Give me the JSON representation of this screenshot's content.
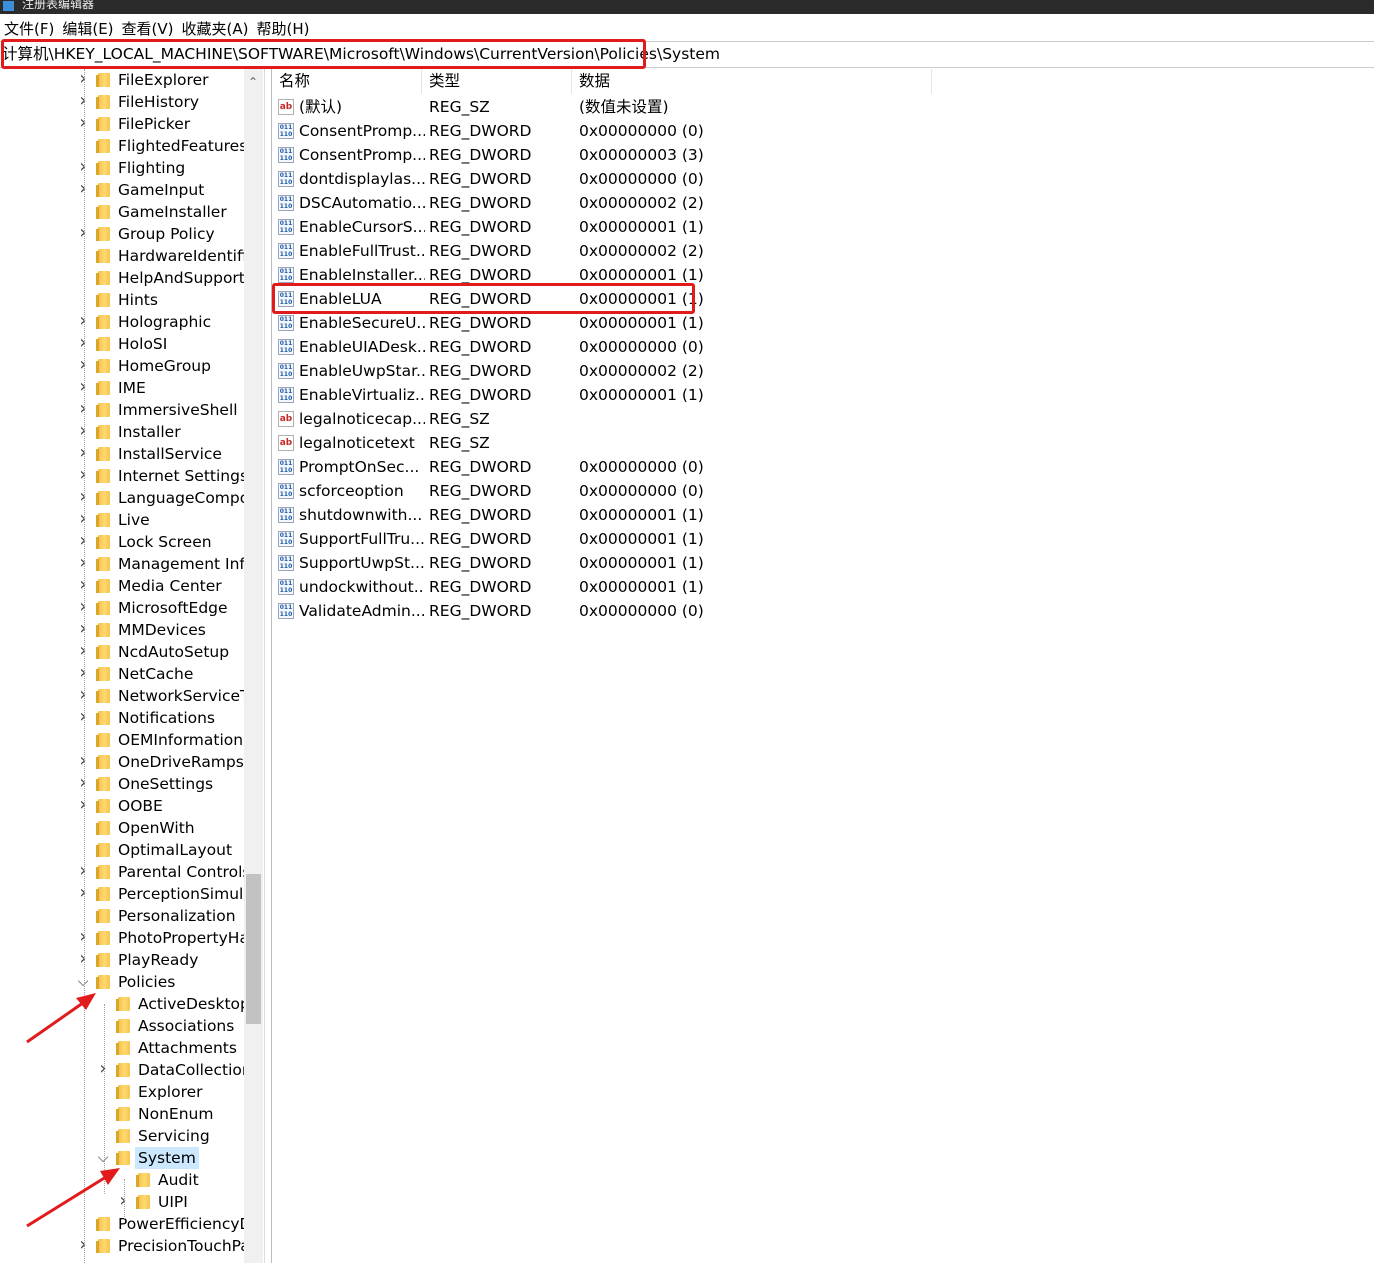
{
  "window": {
    "title": "注册表编辑器"
  },
  "menu": [
    "文件(F)",
    "编辑(E)",
    "查看(V)",
    "收藏夹(A)",
    "帮助(H)"
  ],
  "address": "计算机\\HKEY_LOCAL_MACHINE\\SOFTWARE\\Microsoft\\Windows\\CurrentVersion\\Policies\\System",
  "columns": {
    "name": "名称",
    "type": "类型",
    "data": "数据"
  },
  "tree": [
    {
      "label": "FileExplorer",
      "expand": "collapsed",
      "level": 0
    },
    {
      "label": "FileHistory",
      "expand": "collapsed",
      "level": 0
    },
    {
      "label": "FilePicker",
      "expand": "collapsed",
      "level": 0
    },
    {
      "label": "FlightedFeatures",
      "expand": "none",
      "level": 0
    },
    {
      "label": "Flighting",
      "expand": "collapsed",
      "level": 0
    },
    {
      "label": "GameInput",
      "expand": "collapsed",
      "level": 0
    },
    {
      "label": "GameInstaller",
      "expand": "none",
      "level": 0
    },
    {
      "label": "Group Policy",
      "expand": "collapsed",
      "level": 0
    },
    {
      "label": "HardwareIdentific",
      "expand": "none",
      "level": 0
    },
    {
      "label": "HelpAndSupport",
      "expand": "none",
      "level": 0
    },
    {
      "label": "Hints",
      "expand": "none",
      "level": 0
    },
    {
      "label": "Holographic",
      "expand": "collapsed",
      "level": 0
    },
    {
      "label": "HoloSI",
      "expand": "collapsed",
      "level": 0
    },
    {
      "label": "HomeGroup",
      "expand": "collapsed",
      "level": 0
    },
    {
      "label": "IME",
      "expand": "collapsed",
      "level": 0
    },
    {
      "label": "ImmersiveShell",
      "expand": "collapsed",
      "level": 0
    },
    {
      "label": "Installer",
      "expand": "collapsed",
      "level": 0
    },
    {
      "label": "InstallService",
      "expand": "collapsed",
      "level": 0
    },
    {
      "label": "Internet Settings",
      "expand": "collapsed",
      "level": 0
    },
    {
      "label": "LanguageCompo",
      "expand": "collapsed",
      "level": 0
    },
    {
      "label": "Live",
      "expand": "collapsed",
      "level": 0
    },
    {
      "label": "Lock Screen",
      "expand": "collapsed",
      "level": 0
    },
    {
      "label": "Management Infr",
      "expand": "collapsed",
      "level": 0
    },
    {
      "label": "Media Center",
      "expand": "collapsed",
      "level": 0
    },
    {
      "label": "MicrosoftEdge",
      "expand": "collapsed",
      "level": 0
    },
    {
      "label": "MMDevices",
      "expand": "collapsed",
      "level": 0
    },
    {
      "label": "NcdAutoSetup",
      "expand": "collapsed",
      "level": 0
    },
    {
      "label": "NetCache",
      "expand": "collapsed",
      "level": 0
    },
    {
      "label": "NetworkServiceT",
      "expand": "collapsed",
      "level": 0
    },
    {
      "label": "Notifications",
      "expand": "collapsed",
      "level": 0
    },
    {
      "label": "OEMInformation",
      "expand": "none",
      "level": 0
    },
    {
      "label": "OneDriveRamps",
      "expand": "collapsed",
      "level": 0
    },
    {
      "label": "OneSettings",
      "expand": "collapsed",
      "level": 0
    },
    {
      "label": "OOBE",
      "expand": "collapsed",
      "level": 0
    },
    {
      "label": "OpenWith",
      "expand": "none",
      "level": 0
    },
    {
      "label": "OptimalLayout",
      "expand": "none",
      "level": 0
    },
    {
      "label": "Parental Controls",
      "expand": "collapsed",
      "level": 0
    },
    {
      "label": "PerceptionSimula",
      "expand": "collapsed",
      "level": 0
    },
    {
      "label": "Personalization",
      "expand": "none",
      "level": 0
    },
    {
      "label": "PhotoPropertyHa",
      "expand": "collapsed",
      "level": 0
    },
    {
      "label": "PlayReady",
      "expand": "collapsed",
      "level": 0
    },
    {
      "label": "Policies",
      "expand": "expanded",
      "level": 0
    },
    {
      "label": "ActiveDesktop",
      "expand": "none",
      "level": 1
    },
    {
      "label": "Associations",
      "expand": "none",
      "level": 1
    },
    {
      "label": "Attachments",
      "expand": "none",
      "level": 1
    },
    {
      "label": "DataCollection",
      "expand": "collapsed",
      "level": 1
    },
    {
      "label": "Explorer",
      "expand": "none",
      "level": 1
    },
    {
      "label": "NonEnum",
      "expand": "none",
      "level": 1
    },
    {
      "label": "Servicing",
      "expand": "none",
      "level": 1
    },
    {
      "label": "System",
      "expand": "expanded",
      "level": 1,
      "selected": true
    },
    {
      "label": "Audit",
      "expand": "none",
      "level": 2
    },
    {
      "label": "UIPI",
      "expand": "collapsed",
      "level": 2
    },
    {
      "label": "PowerEfficiencyD",
      "expand": "none",
      "level": 0
    },
    {
      "label": "PrecisionTouchPa",
      "expand": "collapsed",
      "level": 0
    }
  ],
  "values": [
    {
      "icon": "ab",
      "name": "(默认)",
      "type": "REG_SZ",
      "data": "(数值未设置)"
    },
    {
      "icon": "dw",
      "name": "ConsentPromp...",
      "type": "REG_DWORD",
      "data": "0x00000000 (0)"
    },
    {
      "icon": "dw",
      "name": "ConsentPromp...",
      "type": "REG_DWORD",
      "data": "0x00000003 (3)"
    },
    {
      "icon": "dw",
      "name": "dontdisplaylas...",
      "type": "REG_DWORD",
      "data": "0x00000000 (0)"
    },
    {
      "icon": "dw",
      "name": "DSCAutomatio...",
      "type": "REG_DWORD",
      "data": "0x00000002 (2)"
    },
    {
      "icon": "dw",
      "name": "EnableCursorS...",
      "type": "REG_DWORD",
      "data": "0x00000001 (1)"
    },
    {
      "icon": "dw",
      "name": "EnableFullTrust...",
      "type": "REG_DWORD",
      "data": "0x00000002 (2)"
    },
    {
      "icon": "dw",
      "name": "EnableInstaller...",
      "type": "REG_DWORD",
      "data": "0x00000001 (1)"
    },
    {
      "icon": "dw",
      "name": "EnableLUA",
      "type": "REG_DWORD",
      "data": "0x00000001 (1)"
    },
    {
      "icon": "dw",
      "name": "EnableSecureU...",
      "type": "REG_DWORD",
      "data": "0x00000001 (1)"
    },
    {
      "icon": "dw",
      "name": "EnableUIADesk...",
      "type": "REG_DWORD",
      "data": "0x00000000 (0)"
    },
    {
      "icon": "dw",
      "name": "EnableUwpStar...",
      "type": "REG_DWORD",
      "data": "0x00000002 (2)"
    },
    {
      "icon": "dw",
      "name": "EnableVirtualiz...",
      "type": "REG_DWORD",
      "data": "0x00000001 (1)"
    },
    {
      "icon": "ab",
      "name": "legalnoticecap...",
      "type": "REG_SZ",
      "data": ""
    },
    {
      "icon": "ab",
      "name": "legalnoticetext",
      "type": "REG_SZ",
      "data": ""
    },
    {
      "icon": "dw",
      "name": "PromptOnSec...",
      "type": "REG_DWORD",
      "data": "0x00000000 (0)"
    },
    {
      "icon": "dw",
      "name": "scforceoption",
      "type": "REG_DWORD",
      "data": "0x00000000 (0)"
    },
    {
      "icon": "dw",
      "name": "shutdownwith...",
      "type": "REG_DWORD",
      "data": "0x00000001 (1)"
    },
    {
      "icon": "dw",
      "name": "SupportFullTru...",
      "type": "REG_DWORD",
      "data": "0x00000001 (1)"
    },
    {
      "icon": "dw",
      "name": "SupportUwpSt...",
      "type": "REG_DWORD",
      "data": "0x00000001 (1)"
    },
    {
      "icon": "dw",
      "name": "undockwithout...",
      "type": "REG_DWORD",
      "data": "0x00000001 (1)"
    },
    {
      "icon": "dw",
      "name": "ValidateAdmin...",
      "type": "REG_DWORD",
      "data": "0x00000000 (0)"
    }
  ],
  "icons": {
    "sz_icon_text": "ab",
    "dword_icon_text": "011\n110"
  },
  "colors": {
    "annotation": "#e11b1b",
    "selection": "#cce8ff"
  }
}
